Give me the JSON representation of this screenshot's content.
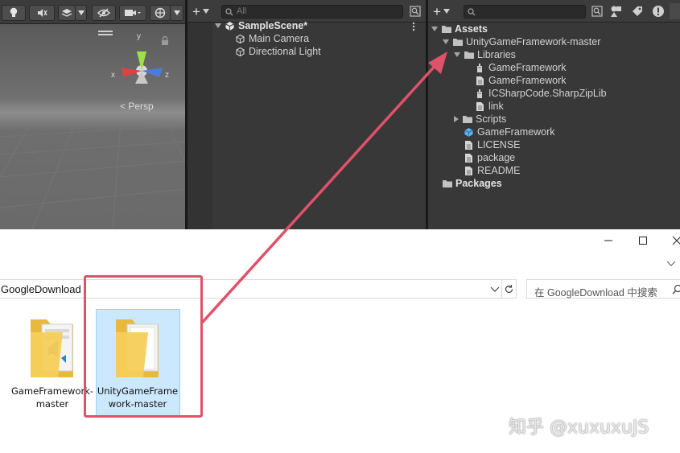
{
  "scene": {
    "persp_label": "< Persp",
    "axis_y": "y",
    "axis_x": "x",
    "axis_z": "z"
  },
  "hierarchy": {
    "search_placeholder": "All",
    "scene_name": "SampleScene*",
    "items": [
      "Main Camera",
      "Directional Light"
    ]
  },
  "project": {
    "assets_label": "Assets",
    "packages_label": "Packages",
    "tree": [
      {
        "label": "UnityGameFramework-master",
        "icon": "folder-icon",
        "depth": 1,
        "expander": "down"
      },
      {
        "label": "Libraries",
        "icon": "folder-icon",
        "depth": 2,
        "expander": "down"
      },
      {
        "label": "GameFramework",
        "icon": "assembly-icon",
        "depth": 3,
        "expander": "none"
      },
      {
        "label": "GameFramework",
        "icon": "document-icon",
        "depth": 3,
        "expander": "none"
      },
      {
        "label": "ICSharpCode.SharpZipLib",
        "icon": "assembly-icon",
        "depth": 3,
        "expander": "none"
      },
      {
        "label": "link",
        "icon": "document-icon",
        "depth": 3,
        "expander": "none"
      },
      {
        "label": "Scripts",
        "icon": "folder-icon",
        "depth": 2,
        "expander": "right"
      },
      {
        "label": "GameFramework",
        "icon": "cube-prefab-icon",
        "depth": 2,
        "expander": "none"
      },
      {
        "label": "LICENSE",
        "icon": "document-icon",
        "depth": 2,
        "expander": "none"
      },
      {
        "label": "package",
        "icon": "document-icon",
        "depth": 2,
        "expander": "none"
      },
      {
        "label": "README",
        "icon": "document-icon",
        "depth": 2,
        "expander": "none"
      }
    ]
  },
  "explorer": {
    "address": "GoogleDownload",
    "search_placeholder": "在 GoogleDownload 中搜索",
    "window_controls": [
      "minimize-icon",
      "maximize-icon",
      "close-icon"
    ],
    "items": [
      {
        "label": "GameFramework-master",
        "selected": false
      },
      {
        "label": "UnityGameFramework-master",
        "selected": true
      }
    ]
  },
  "annotation": {
    "color": "#e0516a"
  },
  "watermark": "知乎 @xuxuxuJS"
}
